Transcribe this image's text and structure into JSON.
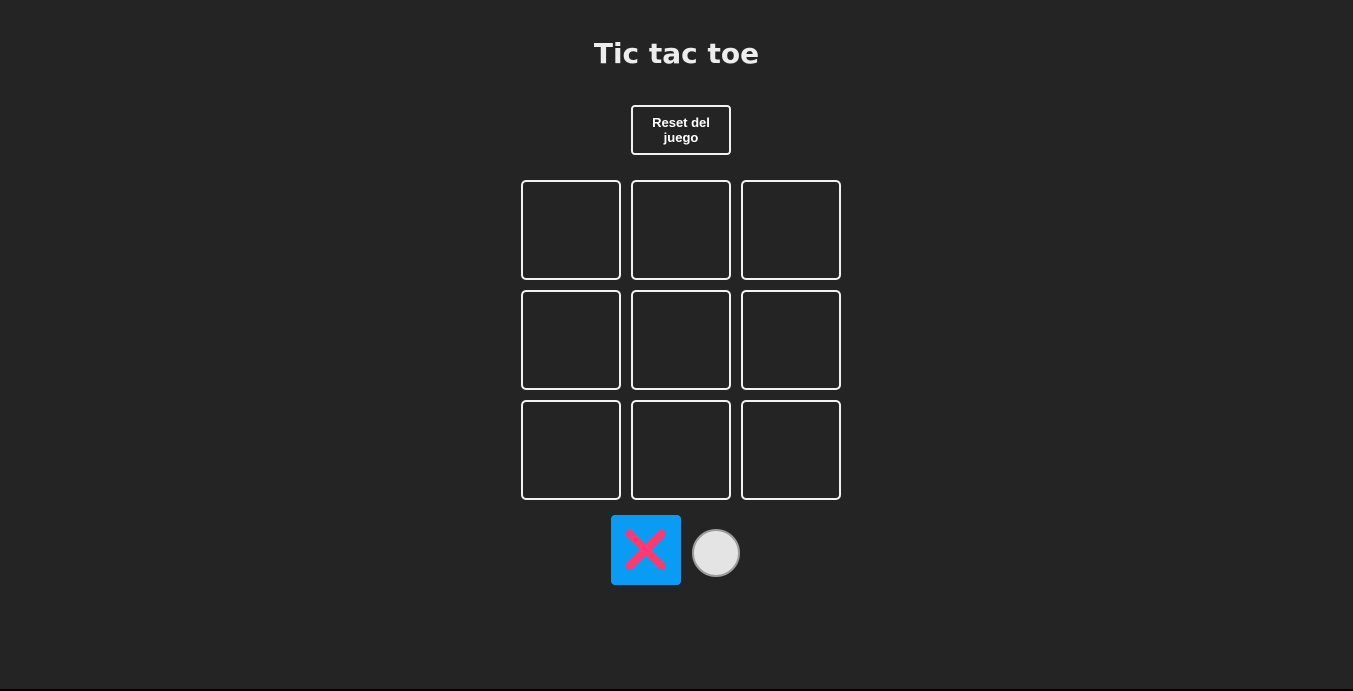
{
  "title": "Tic tac toe",
  "reset_label": "Reset del juego",
  "board": {
    "cells": [
      "",
      "",
      "",
      "",
      "",
      "",
      "",
      "",
      ""
    ]
  },
  "turn": {
    "current": "X",
    "x_marker_icon": "x-mark-icon",
    "o_marker_icon": "circle-icon"
  },
  "colors": {
    "background": "#242424",
    "x_active_bg": "#0a9bf5",
    "x_mark": "#ff3a72",
    "o_marker": "#e4e4e4"
  }
}
